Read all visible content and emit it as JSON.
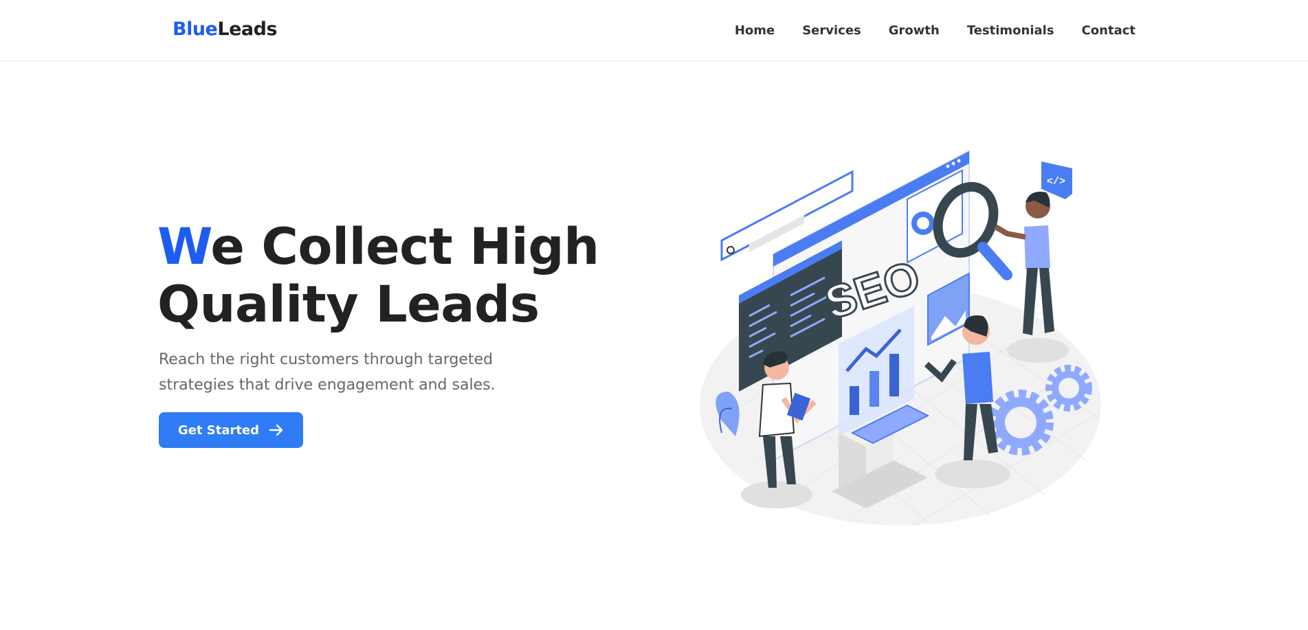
{
  "brand": {
    "part1": "Blue",
    "part2": "Leads"
  },
  "nav": {
    "items": [
      "Home",
      "Services",
      "Growth",
      "Testimonials",
      "Contact"
    ]
  },
  "hero": {
    "title_first_letter": "W",
    "title_line1_rest": "e Collect High",
    "title_line2": "Quality Leads",
    "subtitle_line1": "Reach the right customers through targeted",
    "subtitle_line2": "strategies that drive engagement and sales.",
    "cta_label": "Get Started"
  },
  "illustration": {
    "seo_text": "SEO"
  },
  "colors": {
    "brand_blue": "#1d5cf0",
    "button_blue": "#2f7cf6",
    "text_dark": "#222222",
    "text_muted": "#666666"
  }
}
